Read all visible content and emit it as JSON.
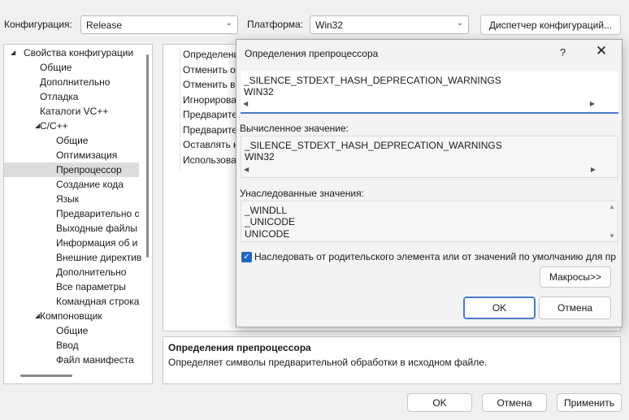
{
  "toolbar": {
    "configuration_label": "Конфигурация:",
    "configuration_value": "Release",
    "platform_label": "Платформа:",
    "platform_value": "Win32",
    "config_manager_button": "Диспетчер конфигураций..."
  },
  "tree": {
    "items": [
      {
        "label": "Свойства конфигурации",
        "depth": 0,
        "expanded": true
      },
      {
        "label": "Общие",
        "depth": 1
      },
      {
        "label": "Дополнительно",
        "depth": 1
      },
      {
        "label": "Отладка",
        "depth": 1
      },
      {
        "label": "Каталоги VC++",
        "depth": 1
      },
      {
        "label": "C/C++",
        "depth": 1,
        "expanded": true
      },
      {
        "label": "Общие",
        "depth": 2
      },
      {
        "label": "Оптимизация",
        "depth": 2
      },
      {
        "label": "Препроцессор",
        "depth": 2,
        "selected": true
      },
      {
        "label": "Создание кода",
        "depth": 2
      },
      {
        "label": "Язык",
        "depth": 2
      },
      {
        "label": "Предварительно с",
        "depth": 2
      },
      {
        "label": "Выходные файлы",
        "depth": 2
      },
      {
        "label": "Информация об и",
        "depth": 2
      },
      {
        "label": "Внешние директив",
        "depth": 2
      },
      {
        "label": "Дополнительно",
        "depth": 2
      },
      {
        "label": "Все параметры",
        "depth": 2
      },
      {
        "label": "Командная строка",
        "depth": 2
      },
      {
        "label": "Компоновщик",
        "depth": 1,
        "expanded": true
      },
      {
        "label": "Общие",
        "depth": 2
      },
      {
        "label": "Ввод",
        "depth": 2
      },
      {
        "label": "Файл манифеста",
        "depth": 2
      }
    ]
  },
  "property_grid": {
    "rows": [
      "Определения",
      "Отменить о",
      "Отменить вс",
      "Игнорирова",
      "Предварите",
      "Предварите",
      "Оставлять к",
      "Использова"
    ]
  },
  "description": {
    "title": "Определения препроцессора",
    "text": "Определяет символы предварительной обработки в исходном файле."
  },
  "dialog": {
    "title": "Определения препроцессора",
    "help": "?",
    "close": "✕",
    "edit_lines": [
      "_SILENCE_STDEXT_HASH_DEPRECATION_WARNINGS",
      "WIN32"
    ],
    "computed_label": "Вычисленное значение:",
    "computed_lines": [
      "_SILENCE_STDEXT_HASH_DEPRECATION_WARNINGS",
      "WIN32"
    ],
    "inherited_label": "Унаследованные значения:",
    "inherited_lines": [
      "_WINDLL",
      "_UNICODE",
      "UNICODE"
    ],
    "inherit_checkbox_label": "Наследовать от родительского элемента или от значений по умолчанию для пр",
    "inherit_checked": true,
    "macros_button": "Макросы>>",
    "ok_button": "OK",
    "cancel_button": "Отмена"
  },
  "footer": {
    "ok_button": "OK",
    "cancel_button": "Отмена",
    "apply_button": "Применить"
  },
  "colors": {
    "accent": "#4a7bc8",
    "checkbox": "#1f66c4",
    "selection": "#dcdcdc"
  }
}
